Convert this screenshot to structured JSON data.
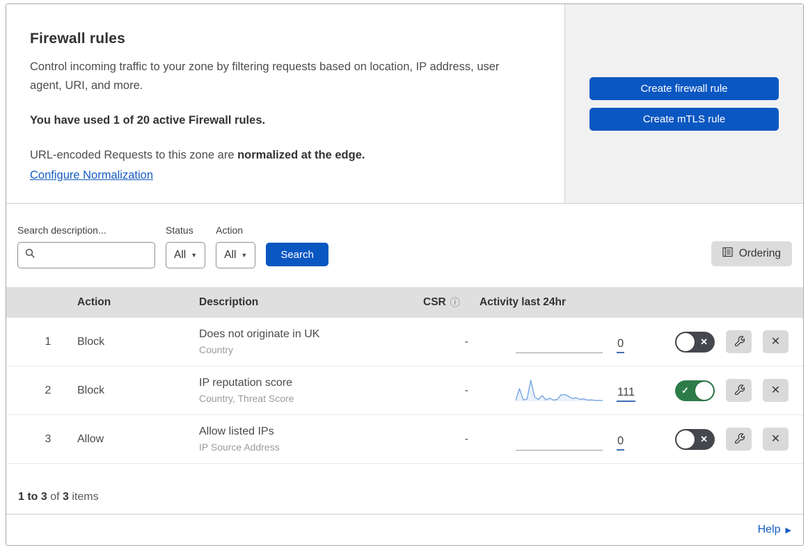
{
  "header": {
    "title": "Firewall rules",
    "description": "Control incoming traffic to your zone by filtering requests based on location, IP address, user agent, URI, and more.",
    "usage_notice": "You have used 1 of 20 active Firewall rules.",
    "normalization_prefix": "URL-encoded Requests to this zone are ",
    "normalization_bold": "normalized at the edge.",
    "normalization_link": "Configure Normalization",
    "create_firewall_button": "Create firewall rule",
    "create_mtls_button": "Create mTLS rule"
  },
  "filters": {
    "search_label": "Search description...",
    "search_value": "",
    "status_label": "Status",
    "status_value": "All",
    "action_label": "Action",
    "action_value": "All",
    "search_button": "Search",
    "ordering_button": "Ordering"
  },
  "table": {
    "columns": {
      "action": "Action",
      "description": "Description",
      "csr": "CSR",
      "activity": "Activity last 24hr"
    },
    "rows": [
      {
        "number": "1",
        "action": "Block",
        "description": "Does not originate in UK",
        "fields": "Country",
        "csr": "-",
        "activity_count": "0",
        "enabled": false,
        "sparkline": null
      },
      {
        "number": "2",
        "action": "Block",
        "description": "IP reputation score",
        "fields": "Country, Threat Score",
        "csr": "-",
        "activity_count": "111",
        "enabled": true,
        "sparkline": [
          3,
          58,
          6,
          10,
          97,
          20,
          8,
          26,
          6,
          14,
          5,
          8,
          30,
          31,
          22,
          13,
          16,
          8,
          11,
          5,
          6,
          4,
          4,
          3
        ]
      },
      {
        "number": "3",
        "action": "Allow",
        "description": "Allow listed IPs",
        "fields": "IP Source Address",
        "csr": "-",
        "activity_count": "0",
        "enabled": false,
        "sparkline": null
      }
    ]
  },
  "footer": {
    "pagination_range": "1 to 3",
    "pagination_of": " of ",
    "pagination_total": "3",
    "pagination_items": " items",
    "help_label": "Help"
  },
  "icons": {
    "toggle_on_glyph": "✓",
    "toggle_off_glyph": "✕",
    "delete_glyph": "✕",
    "caret_glyph": "▼",
    "info_glyph": "ⓘ",
    "help_arrow_glyph": "▶"
  },
  "colors": {
    "accent_blue": "#0b57c2",
    "link_blue": "#155cc2",
    "toggle_on": "#2d7c48",
    "toggle_off": "#45474d",
    "sparkline_blue": "#79a5e0",
    "header_bg": "#dfdfdf",
    "panel_bg": "#f1f1f1"
  }
}
